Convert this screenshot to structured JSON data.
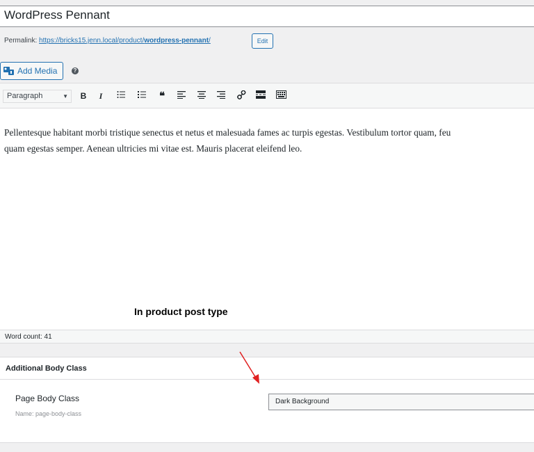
{
  "post": {
    "title": "WordPress Pennant",
    "permalink_label": "Permalink:",
    "permalink_base": "https://bricks15.jenn.local/product/",
    "permalink_slug": "wordpress-pennant",
    "permalink_trailing": "/",
    "edit_label": "Edit"
  },
  "media": {
    "add_media_label": "Add Media",
    "help_glyph": "?"
  },
  "toolbar": {
    "format_value": "Paragraph",
    "buttons": [
      "bold-icon",
      "italic-icon",
      "bullet-list-icon",
      "numbered-list-icon",
      "blockquote-icon",
      "align-left-icon",
      "align-center-icon",
      "align-right-icon",
      "link-icon",
      "read-more-icon",
      "toolbar-toggle-icon"
    ]
  },
  "content": {
    "line1": "Pellentesque habitant morbi tristique senectus et netus et malesuada fames ac turpis egestas. Vestibulum tortor quam, feu",
    "line2": "quam egestas semper. Aenean ultricies mi vitae est. Mauris placerat eleifend leo."
  },
  "annotation": {
    "caption": "In product post type",
    "arrow_color": "#e02020"
  },
  "status": {
    "word_count": "Word count: 41"
  },
  "metabox": {
    "title": "Additional Body Class",
    "field_label": "Page Body Class",
    "field_name": "Name: page-body-class",
    "selected_value": "Dark Background"
  },
  "colors": {
    "accent": "#2271b1",
    "background": "#f0f0f1"
  }
}
